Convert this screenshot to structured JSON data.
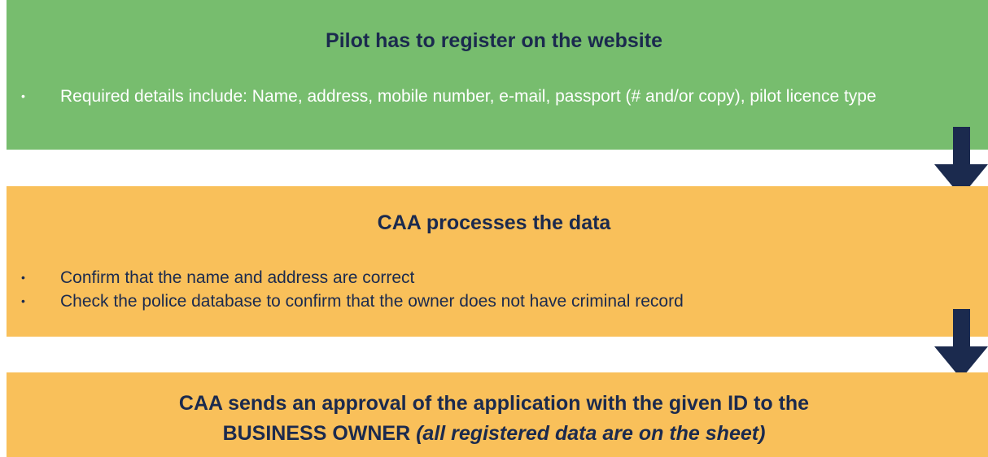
{
  "steps": [
    {
      "title": "Pilot has to register on the website",
      "bullets": [
        "Required details include: Name, address, mobile number, e-mail, passport (# and/or copy), pilot licence type"
      ],
      "color": "#77bd6e"
    },
    {
      "title": "CAA processes the data",
      "bullets": [
        "Confirm that the name and address are correct",
        "Check the police database to confirm that the owner does not have criminal record"
      ],
      "color": "#f9c05a"
    },
    {
      "title_line1": "CAA sends an approval of the application with the given ID to the",
      "title_line2_main": "BUSINESS OWNER",
      "title_line2_italic": "(all registered data are on the sheet)",
      "color": "#f9c05a"
    }
  ],
  "bullet_symbol": "•",
  "arrow_color": "#1b2a4e",
  "arrow_icon": "down-arrow-icon"
}
